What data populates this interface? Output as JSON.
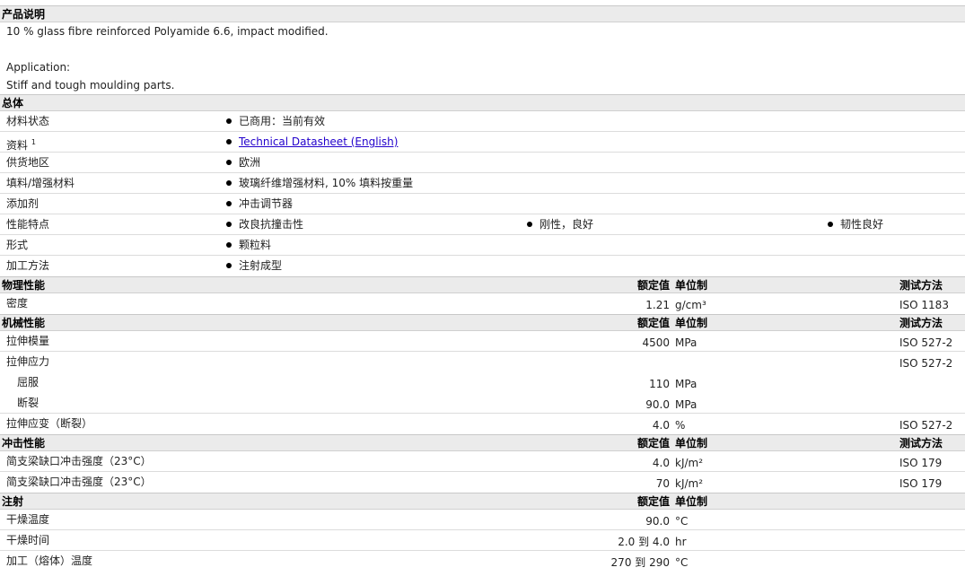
{
  "description": {
    "header": "产品说明",
    "line1": "10 % glass fibre reinforced Polyamide 6.6, impact modified.",
    "line2": "Application:",
    "line3": "Stiff and tough moulding parts."
  },
  "general": {
    "header": "总体",
    "rows": [
      {
        "label": "材料状态",
        "items": [
          "已商用：当前有效"
        ]
      },
      {
        "label": "资料",
        "sup": "1",
        "link": "Technical Datasheet (English)"
      },
      {
        "label": "供货地区",
        "items": [
          "欧洲"
        ]
      },
      {
        "label": "填料/增强材料",
        "items": [
          "玻璃纤维增强材料, 10% 填料按重量"
        ]
      },
      {
        "label": "添加剂",
        "items": [
          "冲击调节器"
        ]
      },
      {
        "label": "性能特点",
        "items": [
          "改良抗撞击性",
          "刚性，良好",
          "韧性良好"
        ]
      },
      {
        "label": "形式",
        "items": [
          "颗粒料"
        ]
      },
      {
        "label": "加工方法",
        "items": [
          "注射成型"
        ]
      }
    ]
  },
  "col_headers": {
    "nominal": "额定值",
    "unit": "单位制",
    "test": "测试方法"
  },
  "physical": {
    "header": "物理性能",
    "rows": [
      {
        "label": "密度",
        "value": "1.21",
        "unit": "g/cm³",
        "test": "ISO 1183"
      }
    ]
  },
  "mechanical": {
    "header": "机械性能",
    "rows": [
      {
        "label": "拉伸模量",
        "value": "4500",
        "unit": "MPa",
        "test": "ISO 527-2"
      },
      {
        "label": "拉伸应力",
        "value": "",
        "unit": "",
        "test": "ISO 527-2"
      },
      {
        "label": "屈服",
        "value": "110",
        "unit": "MPa",
        "test": ""
      },
      {
        "label": "断裂",
        "value": "90.0",
        "unit": "MPa",
        "test": ""
      },
      {
        "label": "拉伸应变（断裂）",
        "value": "4.0",
        "unit": "%",
        "test": "ISO 527-2"
      }
    ]
  },
  "impact": {
    "header": "冲击性能",
    "rows": [
      {
        "label": "简支梁缺口冲击强度（23°C）",
        "value": "4.0",
        "unit": "kJ/m²",
        "test": "ISO 179"
      },
      {
        "label": "简支梁缺口冲击强度（23°C）",
        "value": "70",
        "unit": "kJ/m²",
        "test": "ISO 179"
      }
    ]
  },
  "injection": {
    "header": "注射",
    "rows": [
      {
        "label": "干燥温度",
        "value": "90.0",
        "unit": "°C"
      },
      {
        "label": "干燥时间",
        "value": "2.0 到 4.0",
        "unit": "hr"
      },
      {
        "label": "加工（熔体）温度",
        "value": "270 到 290",
        "unit": "°C"
      }
    ]
  }
}
